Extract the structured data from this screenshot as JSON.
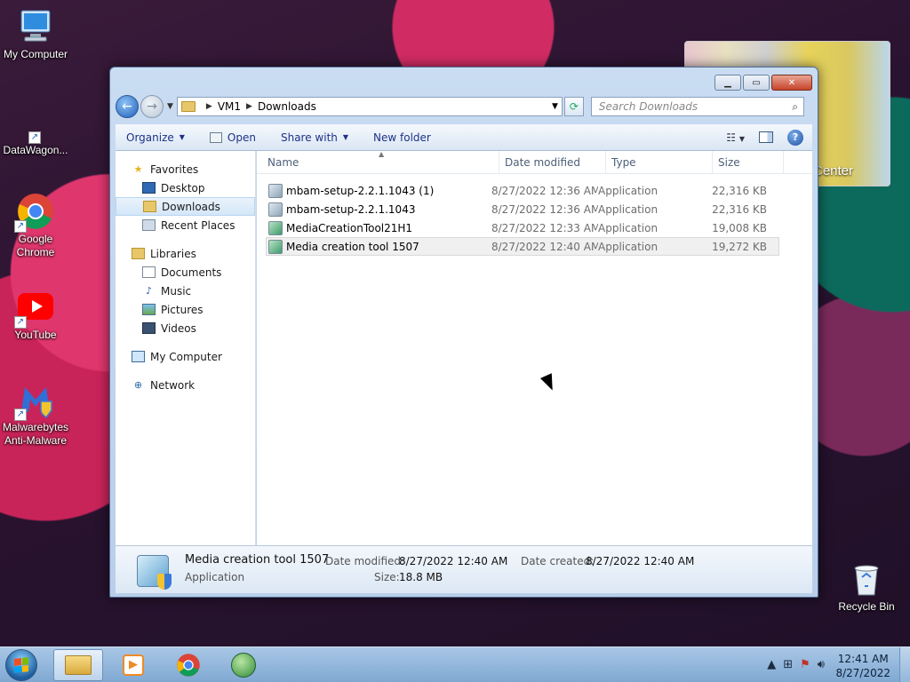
{
  "desktop": {
    "icons": [
      {
        "label": "My Computer"
      },
      {
        "label": "DataWagon..."
      },
      {
        "label": "Google Chrome"
      },
      {
        "label": "YouTube"
      },
      {
        "label": "Malwarebytes Anti-Malware"
      },
      {
        "label": "Recycle Bin"
      }
    ],
    "gadget_caption": "Center"
  },
  "window": {
    "address": {
      "segments": [
        "VM1",
        "Downloads"
      ]
    },
    "search": {
      "placeholder": "Search Downloads"
    },
    "toolbar": {
      "organize": "Organize",
      "open": "Open",
      "share_with": "Share with",
      "new_folder": "New folder"
    },
    "nav": {
      "favorites": "Favorites",
      "desktop": "Desktop",
      "downloads": "Downloads",
      "recent_places": "Recent Places",
      "libraries": "Libraries",
      "documents": "Documents",
      "music": "Music",
      "pictures": "Pictures",
      "videos": "Videos",
      "my_computer": "My Computer",
      "network": "Network"
    },
    "columns": {
      "name": "Name",
      "date": "Date modified",
      "type": "Type",
      "size": "Size"
    },
    "files": [
      {
        "name": "mbam-setup-2.2.1.1043 (1)",
        "date": "8/27/2022 12:36 AM",
        "type": "Application",
        "size": "22,316 KB"
      },
      {
        "name": "mbam-setup-2.2.1.1043",
        "date": "8/27/2022 12:36 AM",
        "type": "Application",
        "size": "22,316 KB"
      },
      {
        "name": "MediaCreationTool21H1",
        "date": "8/27/2022 12:33 AM",
        "type": "Application",
        "size": "19,008 KB"
      },
      {
        "name": "Media creation tool 1507",
        "date": "8/27/2022 12:40 AM",
        "type": "Application",
        "size": "19,272 KB"
      }
    ],
    "details": {
      "name": "Media creation tool 1507",
      "kind": "Application",
      "date_modified_label": "Date modified:",
      "date_modified": "8/27/2022 12:40 AM",
      "date_created_label": "Date created:",
      "date_created": "8/27/2022 12:40 AM",
      "size_label": "Size:",
      "size": "18.8 MB"
    }
  },
  "taskbar": {
    "time": "12:41 AM",
    "date": "8/27/2022"
  }
}
